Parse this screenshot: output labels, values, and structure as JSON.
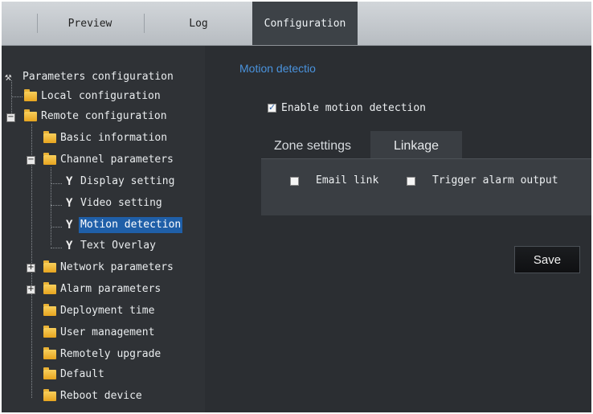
{
  "top_tabs": [
    "Preview",
    "Log",
    "Configuration"
  ],
  "tree": {
    "root": "Parameters configuration",
    "items": {
      "local": "Local configuration",
      "remote": "Remote configuration",
      "basic": "Basic information",
      "channel": "Channel parameters",
      "display": "Display setting",
      "video": "Video setting",
      "motion": "Motion detection",
      "text": "Text Overlay",
      "network": "Network parameters",
      "alarm": "Alarm parameters",
      "deployment": "Deployment time",
      "user": "User management",
      "upgrade": "Remotely upgrade",
      "default": "Default",
      "reboot": "Reboot device"
    },
    "expanders": {
      "minus": "−",
      "plus": "+"
    }
  },
  "main": {
    "title": "Motion detectio",
    "enable_label": "Enable motion detection",
    "enable_checked": true,
    "tabs": {
      "zone": "Zone settings",
      "linkage": "Linkage"
    },
    "linkage": {
      "email": "Email link",
      "email_checked": false,
      "trigger": "Trigger alarm output",
      "trigger_checked": false
    },
    "save": "Save"
  },
  "colors": {
    "accent": "#4a93dd",
    "selected": "#1f5fa8",
    "folder": "#f0b840"
  },
  "icons": {
    "root": "settings-tree-icon",
    "node": "wrench-icon",
    "folder": "folder-icon"
  }
}
